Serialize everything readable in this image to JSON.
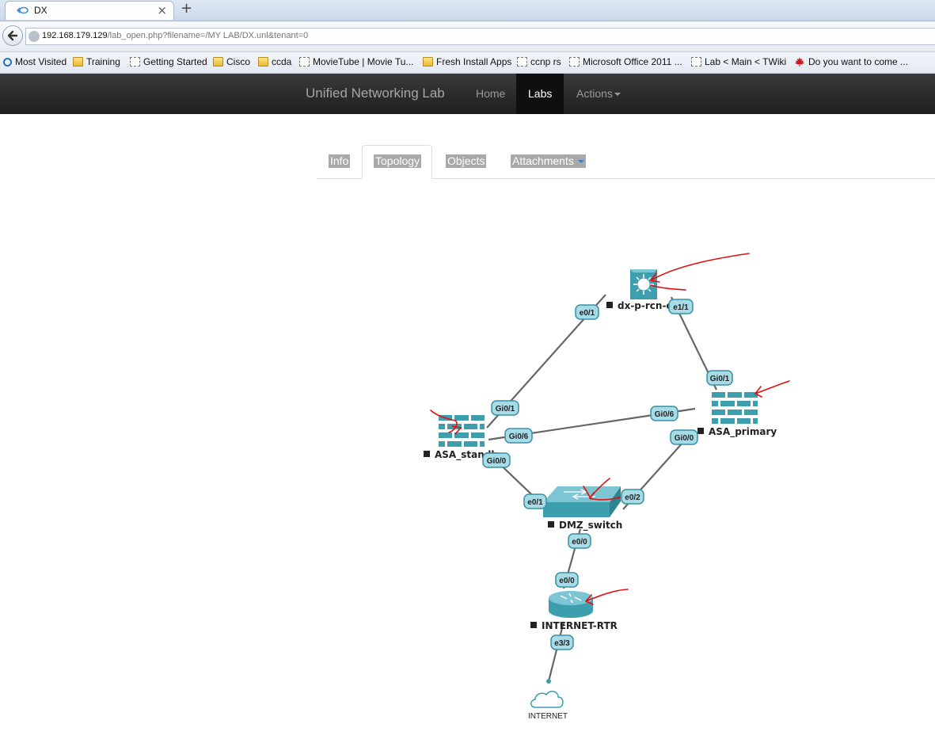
{
  "browser": {
    "tab_title": "DX",
    "url_host": "192.168.179.129",
    "url_path": "/lab_open.php?filename=/MY LAB/DX.unl&tenant=0",
    "bookmarks": [
      {
        "label": "Most Visited",
        "icon": "search-icon"
      },
      {
        "label": "Training",
        "icon": "folder-icon"
      },
      {
        "label": "Getting Started",
        "icon": "page-icon"
      },
      {
        "label": "Cisco",
        "icon": "folder-icon"
      },
      {
        "label": "ccda",
        "icon": "folder-icon"
      },
      {
        "label": "MovieTube | Movie Tu...",
        "icon": "page-icon"
      },
      {
        "label": "Fresh Install Apps",
        "icon": "folder-icon"
      },
      {
        "label": "ccnp rs",
        "icon": "page-icon"
      },
      {
        "label": "Microsoft Office 2011 ...",
        "icon": "page-icon"
      },
      {
        "label": "Lab < Main < TWiki",
        "icon": "page-icon"
      },
      {
        "label": "Do you want to come ...",
        "icon": "maple-leaf-icon"
      }
    ]
  },
  "app": {
    "brand": "Unified Networking Lab",
    "nav": {
      "home": "Home",
      "labs": "Labs",
      "actions": "Actions"
    }
  },
  "lab_tabs": {
    "info": "Info",
    "topology": "Topology",
    "objects": "Objects",
    "attachments": "Attachments"
  },
  "nodes": {
    "core_switch": "dx-p-rcn-cs",
    "asa_standby": "ASA_standb",
    "asa_primary": "ASA_primary",
    "dmz_switch": "DMZ_switch",
    "internet_rtr": "INTERNET-RTR",
    "internet_cloud": "INTERNET"
  },
  "interfaces": {
    "cs_e01": "e0/1",
    "cs_e11": "e1/1",
    "prim_gi01": "Gi0/1",
    "prim_gi06": "Gi0/6",
    "prim_gi00": "Gi0/0",
    "stby_gi01": "Gi0/1",
    "stby_gi06": "Gi0/6",
    "stby_gi00": "Gi0/0",
    "sw_e01": "e0/1",
    "sw_e02": "e0/2",
    "sw_e00": "e0/0",
    "rtr_e00": "e0/0",
    "rtr_e33": "e3/3"
  },
  "colors": {
    "device": "#3d9eae",
    "pill_fill": "#a7dbe6",
    "annotation": "#e01010",
    "navbar": "#222222"
  }
}
